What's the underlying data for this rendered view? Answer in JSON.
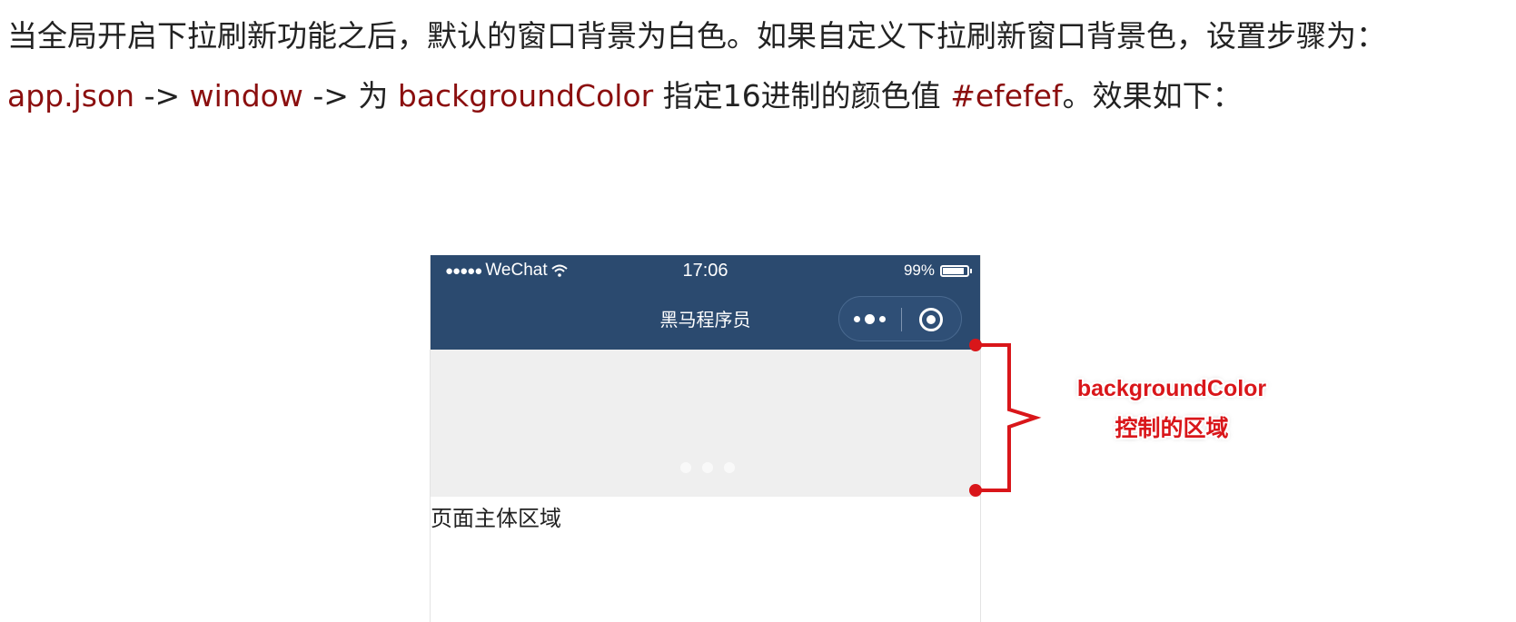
{
  "paragraph": {
    "line1": "当全局开启下拉刷新功能之后，默认的窗口背景为白色。如果自定义下拉刷新窗口背景色，设置步骤为：",
    "seg_app_json": "app.json",
    "seg_arrow1": " -> ",
    "seg_window": "window",
    "seg_arrow2": " -> 为 ",
    "seg_bgcolor": "backgroundColor",
    "seg_mid": " 指定16进制的颜色值 ",
    "seg_hex": "#efefef",
    "seg_end": "。效果如下："
  },
  "phone": {
    "status_carrier": "WeChat",
    "status_time": "17:06",
    "status_battery": "99%",
    "nav_title": "黑马程序员",
    "body_text": "页面主体区域",
    "refresh_bg_color": "#efefef",
    "nav_bg_color": "#2b4a6f"
  },
  "annotation": {
    "line1": "backgroundColor",
    "line2": "控制的区域",
    "color": "#d9161a"
  },
  "colors": {
    "code_text": "#8b0f0f",
    "body_text": "#222222"
  }
}
